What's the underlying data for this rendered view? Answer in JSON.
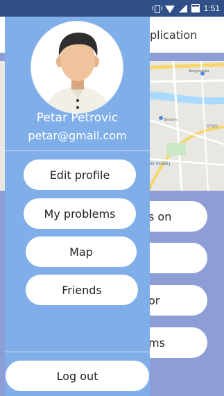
{
  "status_bar": {
    "time": "1:51",
    "icons": [
      "vibrate-icon",
      "wifi-icon",
      "signal-icon",
      "battery-icon"
    ]
  },
  "app": {
    "title_partial": "plication",
    "button_fragments": [
      "s on",
      "",
      "or",
      "ms"
    ],
    "colors": {
      "body": "#8d9ed6",
      "toolbar": "#ffffff"
    },
    "map_labels": [
      "Beogradska",
      "Вуховљ",
      "KРИВ",
      "ЗИ ПЕВАЦ"
    ]
  },
  "drawer": {
    "user_name": "Petar Petrovic",
    "user_email": "petar@gmail.com",
    "menu": {
      "edit_profile": "Edit profile",
      "my_problems": "My problems",
      "map": "Map",
      "friends": "Friends"
    },
    "logout": "Log out",
    "colors": {
      "background": "#80aee8",
      "button": "#ffffff",
      "divider": "#d5e3f6"
    }
  }
}
